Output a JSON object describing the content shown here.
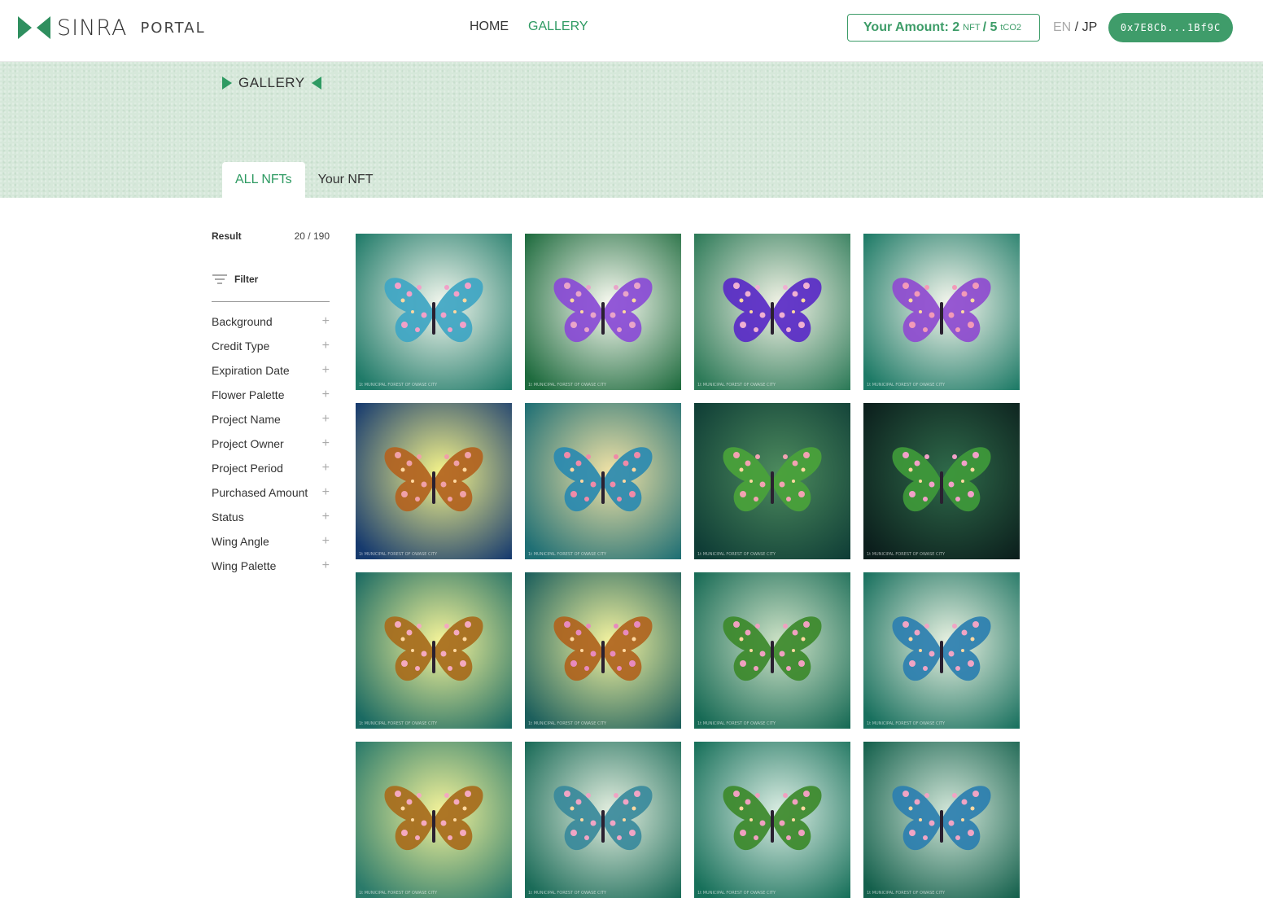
{
  "header": {
    "brand": "SINRA",
    "portal": "PORTAL",
    "nav": [
      {
        "label": "HOME"
      },
      {
        "label": "GALLERY"
      }
    ],
    "amount": {
      "prefix": "Your Amount:",
      "nft_value": "2",
      "nft_unit": "NFT",
      "sep": "/",
      "co2_value": "5",
      "co2_unit": "tCO2"
    },
    "lang": {
      "en": "EN",
      "sep": "/",
      "jp": "JP"
    },
    "wallet": "0x7E8Cb...1Bf9C"
  },
  "banner": {
    "title": "GALLERY",
    "tabs": [
      {
        "label": "ALL NFTs"
      },
      {
        "label": "Your NFT"
      }
    ]
  },
  "sidebar": {
    "result_label": "Result",
    "result_count": "20 / 190",
    "filter_label": "Filter",
    "filters": [
      {
        "label": "Background"
      },
      {
        "label": "Credit Type"
      },
      {
        "label": "Expiration Date"
      },
      {
        "label": "Flower Palette"
      },
      {
        "label": "Project Name"
      },
      {
        "label": "Project Owner"
      },
      {
        "label": "Project Period"
      },
      {
        "label": "Purchased Amount"
      },
      {
        "label": "Status"
      },
      {
        "label": "Wing Angle"
      },
      {
        "label": "Wing Palette"
      }
    ]
  },
  "cards": [
    {
      "bg": [
        "#f4f7ee",
        "#1f7a68"
      ],
      "wing": "#3fa6c4",
      "flower": "#f2a0c8"
    },
    {
      "bg": [
        "#fbfbf2",
        "#1e6b3e"
      ],
      "wing": "#8a4bd6",
      "flower": "#e9a4c9"
    },
    {
      "bg": [
        "#f3f3e6",
        "#2d7a58"
      ],
      "wing": "#5a2bc7",
      "flower": "#f0b0d2"
    },
    {
      "bg": [
        "#f7f7ee",
        "#1d7a66"
      ],
      "wing": "#8f4bd0",
      "flower": "#f39ab8"
    },
    {
      "bg": [
        "#f7f58a",
        "#163a6e"
      ],
      "wing": "#b3631f",
      "flower": "#f0a0a8"
    },
    {
      "bg": [
        "#f3e3a6",
        "#1f6f74"
      ],
      "wing": "#2b8ab0",
      "flower": "#f08aa8"
    },
    {
      "bg": [
        "#4d8b5e",
        "#0f3d36"
      ],
      "wing": "#4aa33a",
      "flower": "#f2a2b2"
    },
    {
      "bg": [
        "#2f6a4a",
        "#0b1e1c"
      ],
      "wing": "#3f9a3a",
      "flower": "#f2a0c8"
    },
    {
      "bg": [
        "#f8f59a",
        "#1a6a62"
      ],
      "wing": "#a86c1c",
      "flower": "#f4a9c0"
    },
    {
      "bg": [
        "#f6f4a0",
        "#1c5f5c"
      ],
      "wing": "#b0641e",
      "flower": "#e88abf"
    },
    {
      "bg": [
        "#cfe3c7",
        "#176a55"
      ],
      "wing": "#3d8a2c",
      "flower": "#f0a0c0"
    },
    {
      "bg": [
        "#eaf2e2",
        "#18705e"
      ],
      "wing": "#2c7fb0",
      "flower": "#f0a4c4"
    },
    {
      "bg": [
        "#f5f39a",
        "#2a7a6a"
      ],
      "wing": "#a86c1c",
      "flower": "#f4a9c0"
    },
    {
      "bg": [
        "#e5efe0",
        "#1a6b58"
      ],
      "wing": "#3a8a9c",
      "flower": "#f0a4c4"
    },
    {
      "bg": [
        "#dceee4",
        "#17705a"
      ],
      "wing": "#3d8a2c",
      "flower": "#f0a0c0"
    },
    {
      "bg": [
        "#d2e6d8",
        "#14604c"
      ],
      "wing": "#2c7fb0",
      "flower": "#f0a4c4"
    }
  ],
  "card_footer": "1t  MUNICIPAL FOREST OF OWASE CITY"
}
